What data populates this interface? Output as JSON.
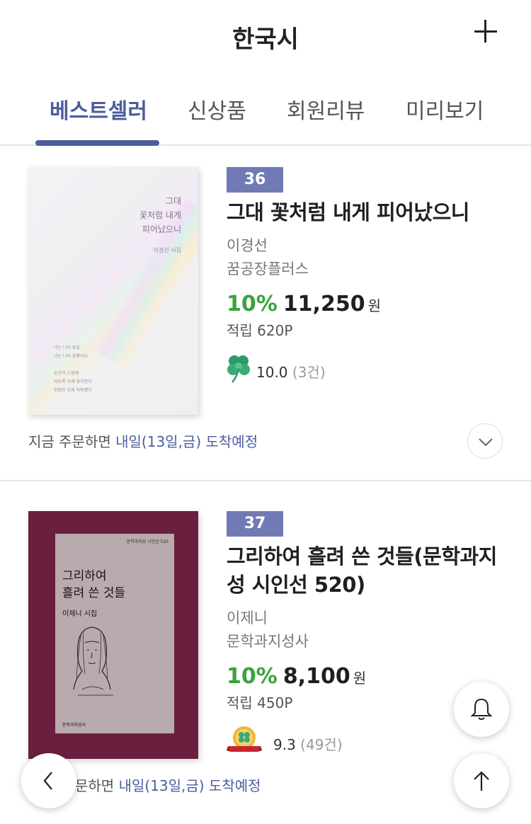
{
  "header": {
    "title": "한국시"
  },
  "tabs": [
    {
      "label": "베스트셀러",
      "active": true
    },
    {
      "label": "신상품",
      "active": false
    },
    {
      "label": "회원리뷰",
      "active": false
    },
    {
      "label": "미리보기",
      "active": false
    }
  ],
  "products": [
    {
      "rank": "36",
      "title": "그대 꽃처럼 내게 피어났으니",
      "author": "이경선",
      "publisher": "꿈공장플러스",
      "discount": "10%",
      "price": "11,250",
      "currency": "원",
      "points": "적립 620P",
      "rating_score": "10.0",
      "rating_count": "(3건)",
      "rating_icon": "clover-icon",
      "delivery_prefix": "지금 주문하면 ",
      "delivery_highlight": "내일(13일,금) 도착예정",
      "cover": {
        "title_lines": [
          "그대",
          "꽃처럼 내게",
          "피어났으니"
        ],
        "author": "이경선 시집",
        "poem_lines": [
          "너는 나의 꽃잎",
          "너는 나의 초행이다",
          "",
          "순간의 스침에",
          "이토록 오래 생각한다",
          "한동안 오래 아파했다"
        ]
      }
    },
    {
      "rank": "37",
      "title": "그리하여 흘려 쓴 것들(문학과지성 시인선 520)",
      "author": "이제니",
      "publisher": "문학과지성사",
      "discount": "10%",
      "price": "8,100",
      "currency": "원",
      "points": "적립 450P",
      "rating_score": "9.3",
      "rating_count": "(49건)",
      "rating_icon": "feel-lucky-badge-icon",
      "delivery_prefix": "문하면 ",
      "delivery_highlight": "내일(13일,금) 도착예정",
      "cover": {
        "series": "문학과지성 시인선 520",
        "title_lines": [
          "그리하여",
          "흘려 쓴 것들"
        ],
        "author": "이제니 시집",
        "publisher": "문학과지성사"
      }
    }
  ],
  "colors": {
    "accent": "#4c5c9d",
    "rank_bg": "#707bb5",
    "discount": "#3ba33b"
  }
}
